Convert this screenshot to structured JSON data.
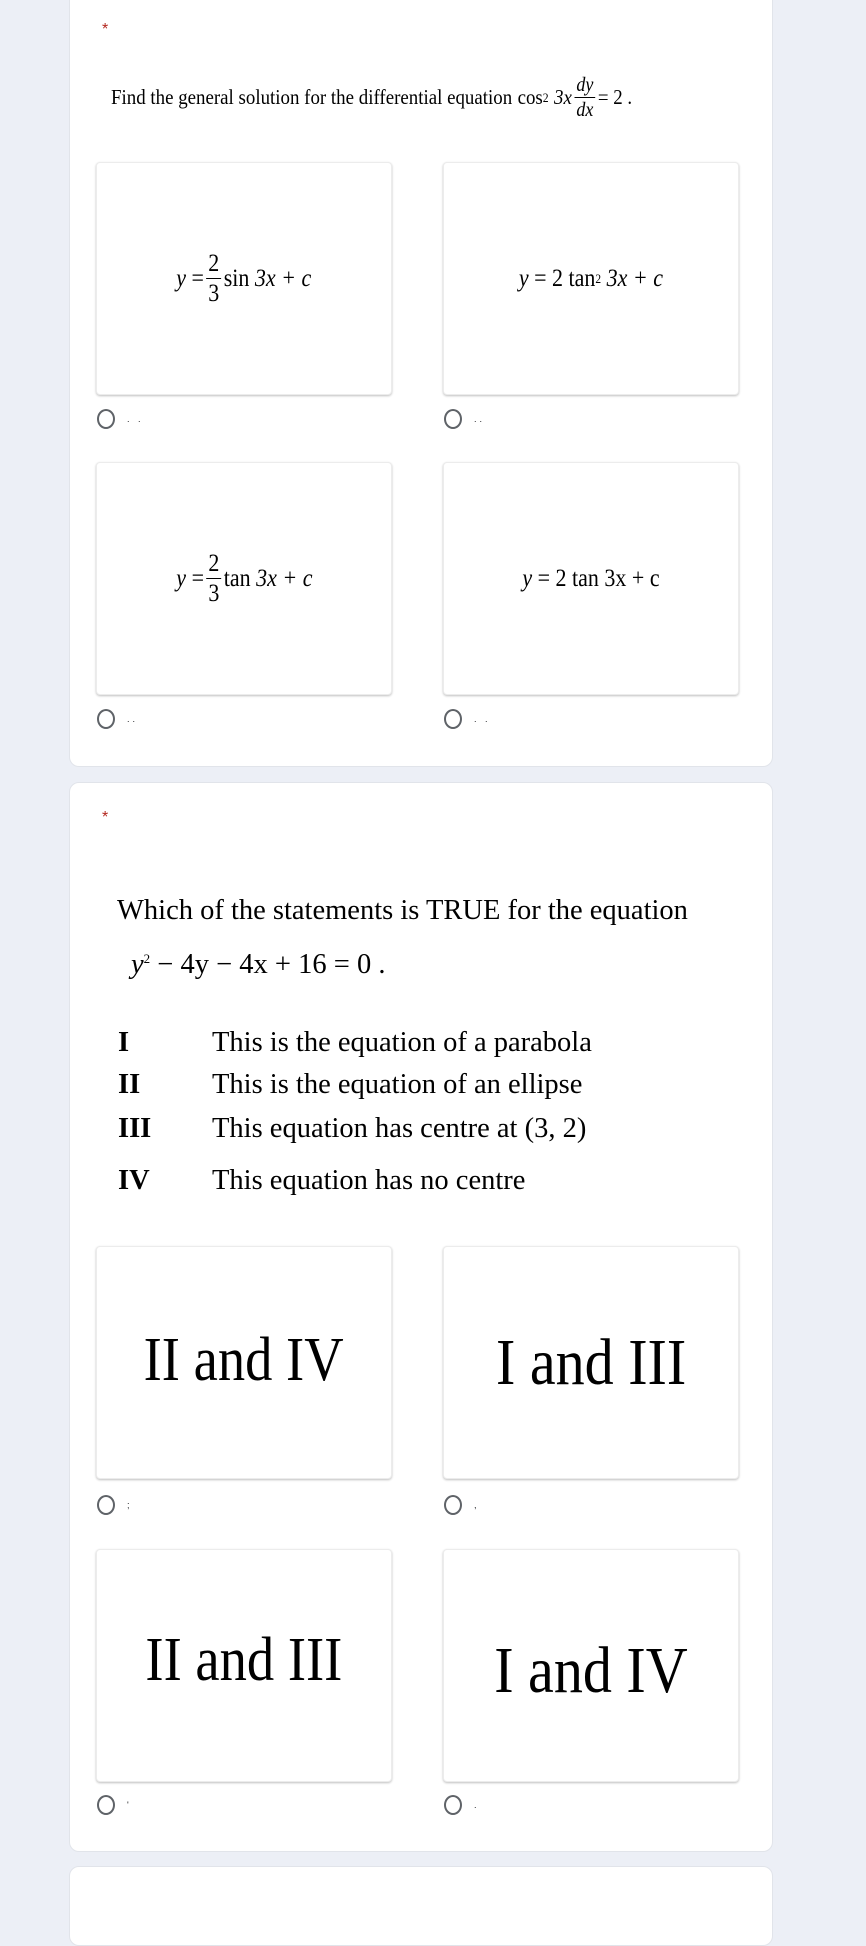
{
  "colors": {
    "background": "#eceff6",
    "required": "#b3261e",
    "radio": "#5f6368"
  },
  "question1": {
    "required_mark": "*",
    "prompt": "Find the general solution for the differential equation",
    "equation": {
      "lhs": "cos",
      "power": "2",
      "arg": "3x",
      "num": "dy",
      "den": "dx",
      "rhs": "= 2 ."
    },
    "options": [
      {
        "label": ". .",
        "formula": {
          "y": "y",
          "eq": "=",
          "num": "2",
          "den": "3",
          "fn": "sin",
          "rest": "3x + c"
        }
      },
      {
        "label": "..",
        "formula": {
          "text_a": "y",
          "text_b": "= 2 tan",
          "power": "2",
          "text_c": "3x + c"
        }
      },
      {
        "label": "..",
        "formula": {
          "y": "y",
          "eq": "=",
          "num": "2",
          "den": "3",
          "fn": "tan",
          "rest": "3x + c"
        }
      },
      {
        "label": ". .",
        "formula": {
          "text_a": "y",
          "text_b": "= 2 tan 3x + c"
        }
      }
    ]
  },
  "question2": {
    "required_mark": "*",
    "prompt": "Which of the statements is TRUE for the equation",
    "equation": {
      "y": "y",
      "power": "2",
      "rest": "− 4y − 4x + 16 = 0 ."
    },
    "statements": [
      {
        "num": "I",
        "text": "This is the equation of a parabola"
      },
      {
        "num": "II",
        "text": "This is the equation of an ellipse"
      },
      {
        "num": "III",
        "text": "This equation has centre at (3, 2)"
      },
      {
        "num": "IV",
        "text": "This equation has no centre"
      }
    ],
    "options": [
      {
        "label": ";",
        "text": "II and IV"
      },
      {
        "label": ",",
        "text": "I and III"
      },
      {
        "label": "'",
        "text": "II and III"
      },
      {
        "label": ".",
        "text": "I and IV"
      }
    ]
  }
}
